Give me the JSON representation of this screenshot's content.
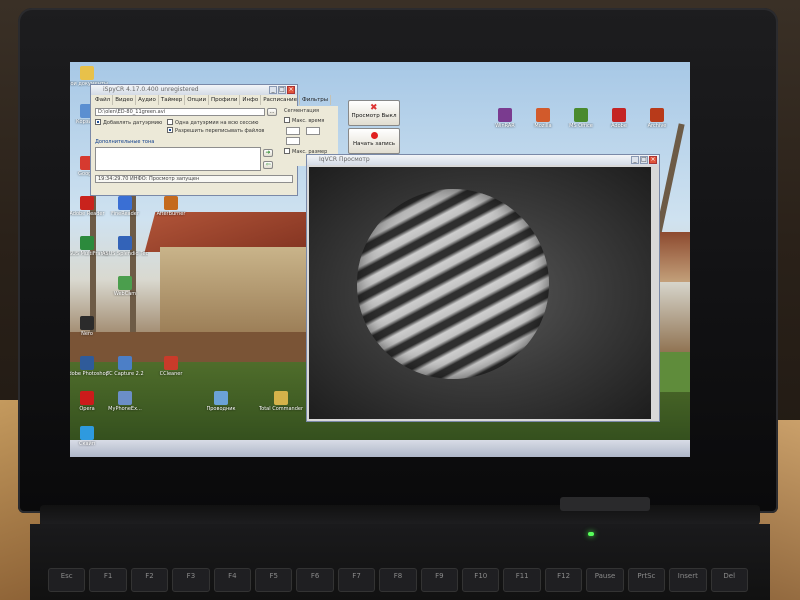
{
  "main_window": {
    "title": "iSpyCR 4.17.0.400 unregistered",
    "menu": [
      "Файл",
      "Видео",
      "Аудио",
      "Таймер",
      "Опции",
      "Профили",
      "Инфо",
      "Расписание",
      "Фильтры"
    ],
    "file_path": "D:\\olen\\ED-80_11green.avi",
    "browse_label": "...",
    "checkbox_timestamp": "Добавлять датуэрмию",
    "checkbox_one_time": "Одна датуэрмия на всю сессию",
    "checkbox_overwrite": "Разрешить переписывать файлов",
    "section_segment": "Сегментация",
    "checkbox_max_time": "Макс. время",
    "checkbox_max_size": "Макс. размер",
    "extra_tone_label": "Дополнительные тона",
    "status_line": "19:34:29.70 ИНФО: Просмотр запущен",
    "preview_button": "Просмотр Выкл",
    "record_button": "Начать запись"
  },
  "preview_window": {
    "title": "IqVCR Просмотр"
  },
  "desktop_icons": [
    {
      "label": "Мои документы",
      "color": "#e8c14a"
    },
    {
      "label": "Корзина",
      "color": "#5b8fd1"
    },
    {
      "label": "Google",
      "color": "#d63a2f"
    },
    {
      "label": "Adobe Reader",
      "color": "#c9231c"
    },
    {
      "label": "ASUS MultiFrame",
      "color": "#2c8a3c"
    },
    {
      "label": "ASUS Splendid Technology",
      "color": "#3363b8"
    },
    {
      "label": "AfterBurner",
      "color": "#c46a1e"
    },
    {
      "label": "FineReader",
      "color": "#3a6fd4"
    },
    {
      "label": "Opera",
      "color": "#cc1b1b"
    },
    {
      "label": "MyPhoneEx...",
      "color": "#6b8ec7"
    },
    {
      "label": "Проводник",
      "color": "#6ba2d6"
    },
    {
      "label": "Total Commander",
      "color": "#d4b24a"
    },
    {
      "label": "CCleaner",
      "color": "#c93b2a"
    },
    {
      "label": "TC Capture 2.2",
      "color": "#4c7fc7"
    },
    {
      "label": "WebCam",
      "color": "#4b9e4d"
    },
    {
      "label": "Adobe Photoshop",
      "color": "#2f5b9a"
    },
    {
      "label": "Nero",
      "color": "#2b2b2b"
    },
    {
      "label": "Скайп",
      "color": "#2e9adf"
    }
  ],
  "tray_icons": [
    {
      "label": "WinRAR",
      "color": "#7a3b8f"
    },
    {
      "label": "Mozilla",
      "color": "#d25a2b"
    },
    {
      "label": "MS Office",
      "color": "#4a8a2d"
    },
    {
      "label": "Adobe",
      "color": "#c42424"
    },
    {
      "label": "Archive",
      "color": "#b83a1a"
    }
  ],
  "keyboard": [
    "Esc",
    "F1",
    "F2",
    "F3",
    "F4",
    "F5",
    "F6",
    "F7",
    "F8",
    "F9",
    "F10",
    "F11",
    "F12",
    "Pause",
    "PrtSc",
    "Insert",
    "Del"
  ]
}
